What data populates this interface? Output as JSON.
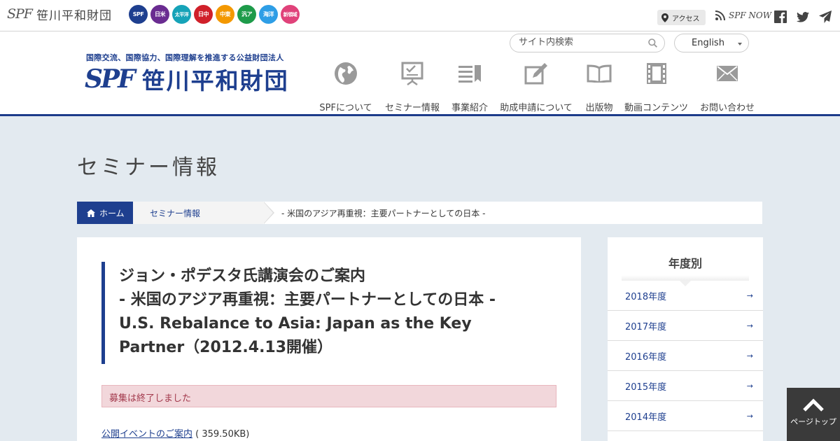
{
  "topbar": {
    "small_logo_mark": "SPF",
    "small_logo_name": "笹川平和財団",
    "badges": [
      {
        "label": "SPF",
        "color": "#1e3f8f"
      },
      {
        "label": "日米",
        "color": "#6a2c91"
      },
      {
        "label": "太平洋",
        "color": "#16a3b8"
      },
      {
        "label": "日中",
        "color": "#d0202a"
      },
      {
        "label": "中東",
        "color": "#f39800"
      },
      {
        "label": "汎ア",
        "color": "#1e9b4a"
      },
      {
        "label": "海洋",
        "color": "#2e9ee6"
      },
      {
        "label": "新領域",
        "color": "#e0427a"
      }
    ],
    "access_label": "アクセス",
    "spfnow_label": "SPF NOW"
  },
  "header": {
    "tagline": "国際交流、国際協力、国際理解を推進する公益財団法人",
    "logo_mark": "SPF",
    "logo_name": "笹川平和財団",
    "search_placeholder": "サイト内検索",
    "language": "English",
    "nav": [
      {
        "label": "SPFについて",
        "icon": "globe-icon"
      },
      {
        "label": "セミナー情報",
        "icon": "presentation-icon"
      },
      {
        "label": "事業紹介",
        "icon": "list-icon"
      },
      {
        "label": "助成申請について",
        "icon": "pencil-icon"
      },
      {
        "label": "出版物",
        "icon": "book-icon"
      },
      {
        "label": "動画コンテンツ",
        "icon": "film-icon"
      },
      {
        "label": "お問い合わせ",
        "icon": "mail-icon"
      }
    ]
  },
  "page": {
    "title": "セミナー情報",
    "breadcrumb": {
      "home": "ホーム",
      "section": "セミナー情報",
      "current": "- 米国のアジア再重視：主要パートナーとしての日本 -"
    }
  },
  "article": {
    "title_lines": [
      "ジョン・ポデスタ氏講演会のご案内",
      "- 米国のアジア再重視：主要パートナーとしての日本 -",
      "U.S. Rebalance to Asia: Japan as the Key",
      "Partner（2012.4.13開催）"
    ],
    "notice": "募集は終了しました",
    "pdf_link": "公開イベントのご案内",
    "pdf_size": "( 359.50KB)"
  },
  "sidebar": {
    "heading": "年度別",
    "years": [
      "2018年度",
      "2017年度",
      "2016年度",
      "2015年度",
      "2014年度"
    ]
  },
  "pagetop_label": "ページトップ"
}
